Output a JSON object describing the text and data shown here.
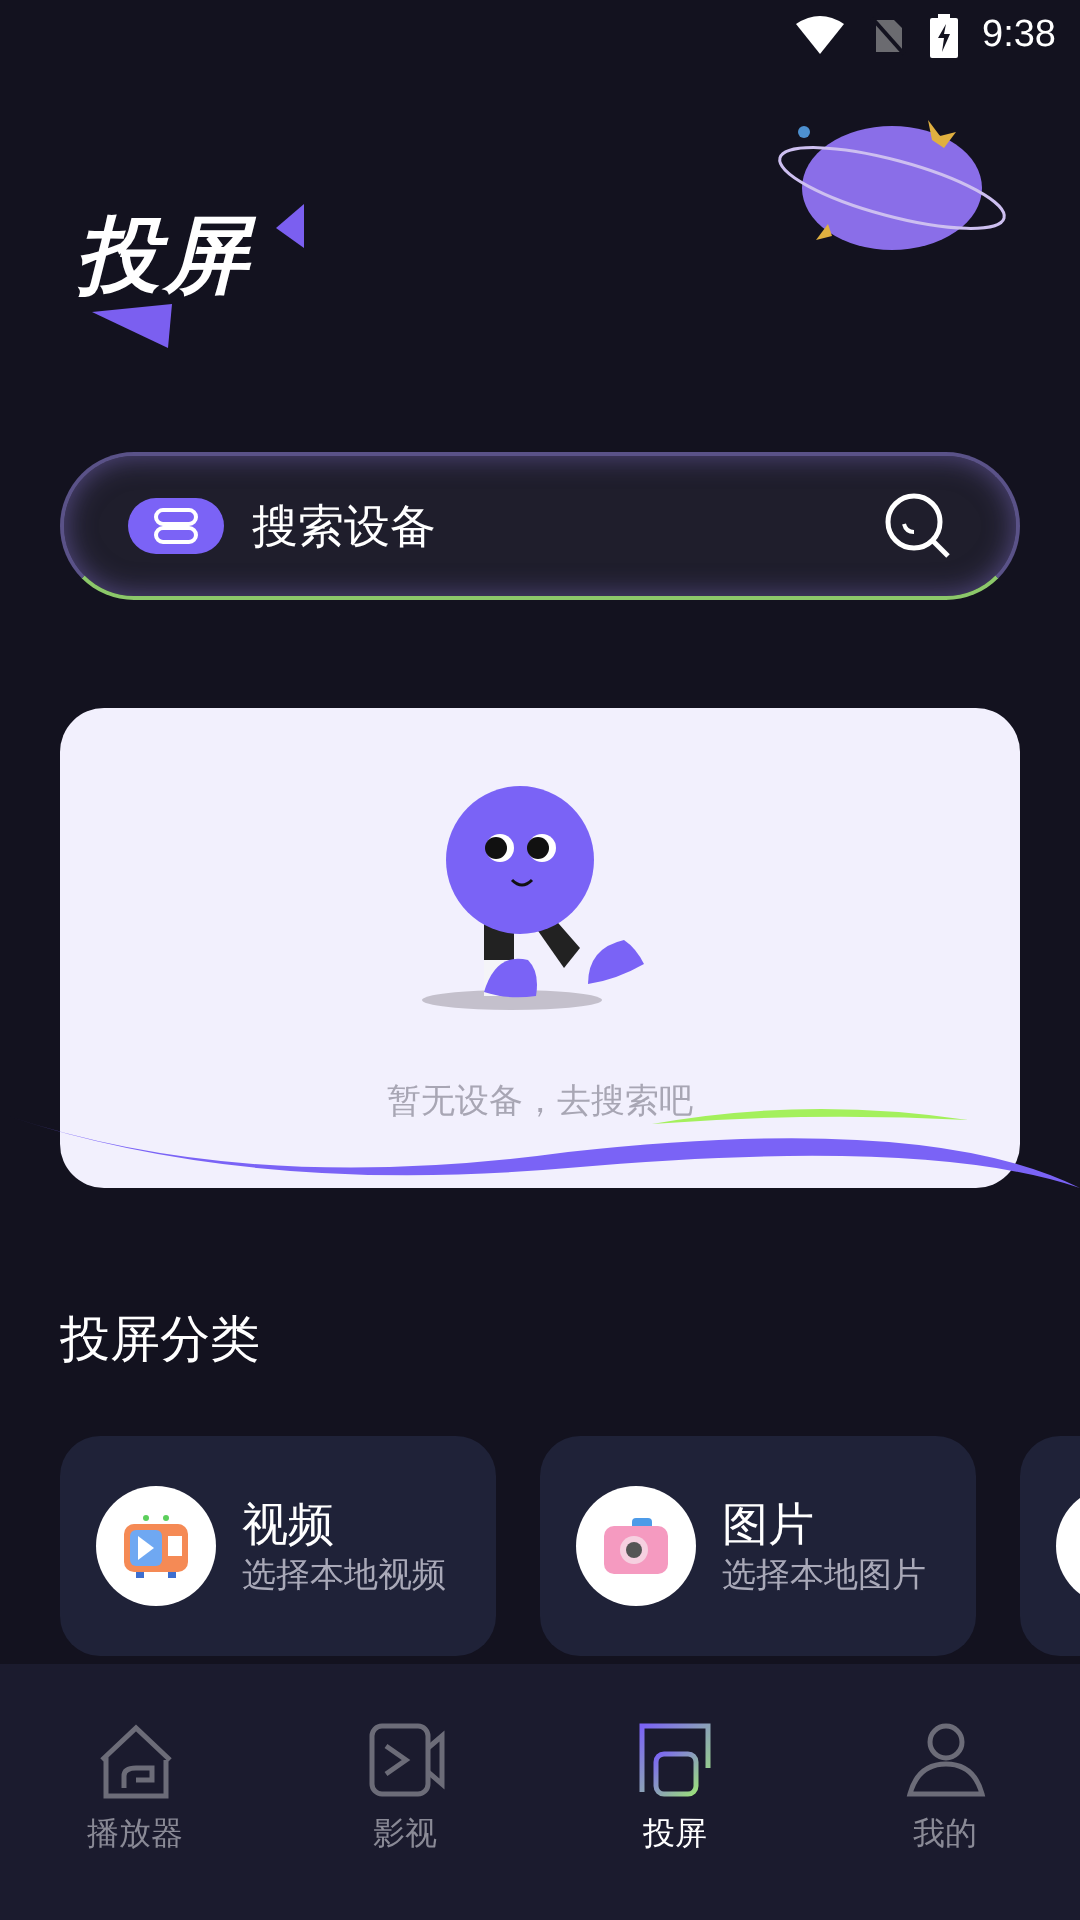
{
  "status_bar": {
    "time": "9:38"
  },
  "header": {
    "title": "投屏"
  },
  "search": {
    "placeholder": "搜索设备"
  },
  "empty_state": {
    "message": "暂无设备，去搜索吧"
  },
  "categories_section": {
    "title": "投屏分类",
    "items": [
      {
        "kind": "video",
        "title": "视频",
        "subtitle": "选择本地视频"
      },
      {
        "kind": "photo",
        "title": "图片",
        "subtitle": "选择本地图片"
      },
      {
        "kind": "partial"
      }
    ]
  },
  "bottom_nav": [
    {
      "kind": "home",
      "label": "播放器",
      "selected": false
    },
    {
      "kind": "video",
      "label": "影视",
      "selected": false
    },
    {
      "kind": "cast",
      "label": "投屏",
      "selected": true
    },
    {
      "kind": "profile",
      "label": "我的",
      "selected": false
    }
  ]
}
